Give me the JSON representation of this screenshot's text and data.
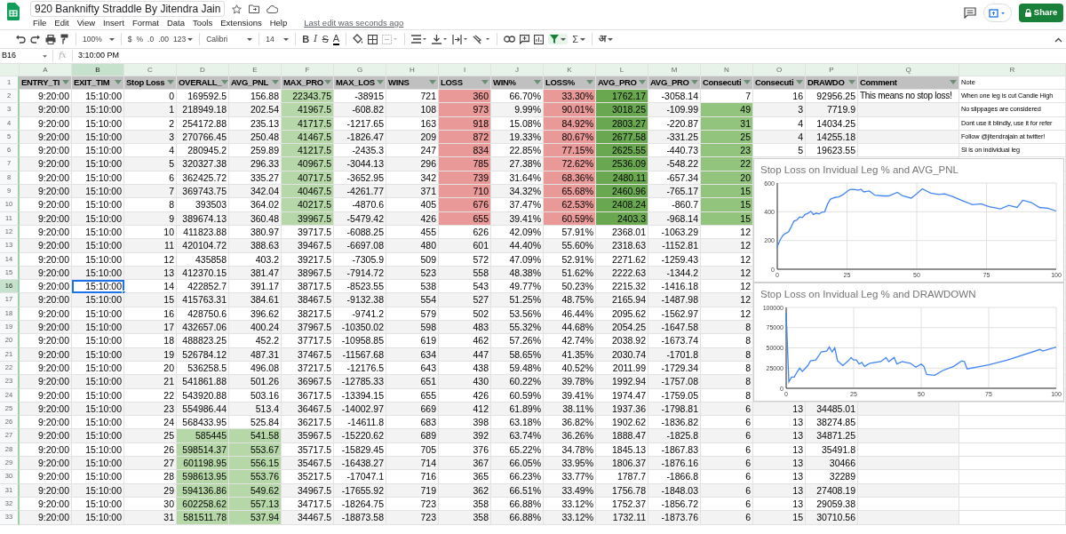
{
  "title": "920 Banknifty Straddle By Jitendra Jain",
  "menu": [
    "File",
    "Edit",
    "View",
    "Insert",
    "Format",
    "Data",
    "Tools",
    "Extensions",
    "Help"
  ],
  "last_edit": "Last edit was seconds ago",
  "share": "Share",
  "toolbar": {
    "zoom": "100%",
    "currency": "$",
    "percent": "%",
    "decrease_decimal": ".0",
    "increase_decimal": ".00",
    "number_format": "123",
    "font": "Calibri",
    "font_size": "14",
    "bold": "B",
    "italic": "I",
    "strikethrough": "S",
    "text_color": "A",
    "functions": "Σ",
    "input_tools": "अ",
    "filter_active": true
  },
  "formula_bar": {
    "cell": "B16",
    "fx": "fx",
    "value": "3:10:00 PM"
  },
  "columns": [
    {
      "letter": "A",
      "selected": false
    },
    {
      "letter": "B",
      "selected": true
    },
    {
      "letter": "C",
      "selected": false
    },
    {
      "letter": "D",
      "selected": false
    },
    {
      "letter": "E",
      "selected": false
    },
    {
      "letter": "F",
      "selected": false
    },
    {
      "letter": "G",
      "selected": false
    },
    {
      "letter": "H",
      "selected": false
    },
    {
      "letter": "I",
      "selected": false
    },
    {
      "letter": "J",
      "selected": false
    },
    {
      "letter": "K",
      "selected": false
    },
    {
      "letter": "L",
      "selected": false
    },
    {
      "letter": "M",
      "selected": false
    },
    {
      "letter": "N",
      "selected": false
    },
    {
      "letter": "O",
      "selected": false
    },
    {
      "letter": "P",
      "selected": false
    },
    {
      "letter": "Q",
      "selected": false
    },
    {
      "letter": "R",
      "selected": false
    }
  ],
  "header_row_number": "1",
  "headers": [
    "ENTRY_TI",
    "EXIT_TIM",
    "Stop Loss",
    "OVERALL_",
    "AVG_PNL",
    "MAX_PRO",
    "MAX_LOS",
    "WINS",
    "LOSS",
    "WIN%",
    "LOSS%",
    "AVG_PRO",
    "AVG_PRO",
    "Consecuti",
    "Consecuti",
    "DRAWDO",
    "Comment"
  ],
  "note_header": "Note",
  "rows": [
    {
      "number": "2",
      "selected": false,
      "cells": [
        "9:20:00",
        "15:10:00",
        "0",
        "169592.5",
        "156.88",
        {
          "text": "22343.75",
          "color": "#b6d7a8"
        },
        "-38915",
        "721",
        {
          "text": "360",
          "color": "#ea9999"
        },
        "66.70%",
        {
          "text": "33.30%",
          "color": "#ea9999"
        },
        {
          "text": "1762.17",
          "color": "#6aa84f"
        },
        "-3058.14",
        "7",
        "16",
        "92956.25"
      ],
      "comment": "This means no stop loss!",
      "note": "When one leg is cut Candle High"
    },
    {
      "number": "3",
      "selected": false,
      "cells": [
        "9:20:00",
        "15:10:00",
        "1",
        "218949.18",
        "202.54",
        {
          "text": "41967.5",
          "color": "#b6d7a8"
        },
        "-608.82",
        "108",
        {
          "text": "973",
          "color": "#ea9999"
        },
        "9.99%",
        {
          "text": "90.01%",
          "color": "#ea9999"
        },
        {
          "text": "3018.25",
          "color": "#6aa84f"
        },
        "-109.99",
        {
          "text": "49",
          "color": "#93c47d"
        },
        "3",
        "7719.9"
      ],
      "note": "No slippages are considered"
    },
    {
      "number": "4",
      "selected": false,
      "cells": [
        "9:20:00",
        "15:10:00",
        "2",
        "254172.88",
        "235.13",
        {
          "text": "41717.5",
          "color": "#b6d7a8"
        },
        "-1217.65",
        "163",
        {
          "text": "918",
          "color": "#ea9999"
        },
        "15.08%",
        {
          "text": "84.92%",
          "color": "#ea9999"
        },
        {
          "text": "2803.27",
          "color": "#6aa84f"
        },
        "-220.87",
        {
          "text": "31",
          "color": "#93c47d"
        },
        "4",
        "14034.25"
      ],
      "note": "Dont use it blindly, use it for refer"
    },
    {
      "number": "5",
      "selected": false,
      "cells": [
        "9:20:00",
        "15:10:00",
        "3",
        "270766.45",
        "250.48",
        {
          "text": "41467.5",
          "color": "#b6d7a8"
        },
        "-1826.47",
        "209",
        {
          "text": "872",
          "color": "#ea9999"
        },
        "19.33%",
        {
          "text": "80.67%",
          "color": "#ea9999"
        },
        {
          "text": "2677.58",
          "color": "#6aa84f"
        },
        "-331.25",
        {
          "text": "25",
          "color": "#93c47d"
        },
        "4",
        "14255.18"
      ],
      "note": "Follow @jitendrajain at twitter!"
    },
    {
      "number": "6",
      "selected": false,
      "cells": [
        "9:20:00",
        "15:10:00",
        "4",
        "280945.2",
        "259.89",
        {
          "text": "41217.5",
          "color": "#b6d7a8"
        },
        "-2435.3",
        "247",
        {
          "text": "834",
          "color": "#ea9999"
        },
        "22.85%",
        {
          "text": "77.15%",
          "color": "#ea9999"
        },
        {
          "text": "2625.55",
          "color": "#6aa84f"
        },
        "-440.73",
        {
          "text": "23",
          "color": "#93c47d"
        },
        "5",
        "19623.55"
      ],
      "note": "Sl is on individual leg"
    },
    {
      "number": "7",
      "selected": false,
      "cells": [
        "9:20:00",
        "15:10:00",
        "5",
        "320327.38",
        "296.33",
        {
          "text": "40967.5",
          "color": "#b6d7a8"
        },
        "-3044.13",
        "296",
        {
          "text": "785",
          "color": "#ea9999"
        },
        "27.38%",
        {
          "text": "72.62%",
          "color": "#ea9999"
        },
        {
          "text": "2536.09",
          "color": "#6aa84f"
        },
        "-548.22",
        {
          "text": "22",
          "color": "#93c47d"
        }
      ]
    },
    {
      "number": "8",
      "selected": false,
      "cells": [
        "9:20:00",
        "15:10:00",
        "6",
        "362425.72",
        "335.27",
        {
          "text": "40717.5",
          "color": "#b6d7a8"
        },
        "-3652.95",
        "342",
        {
          "text": "739",
          "color": "#ea9999"
        },
        "31.64%",
        {
          "text": "68.36%",
          "color": "#ea9999"
        },
        {
          "text": "2480.11",
          "color": "#6aa84f"
        },
        "-657.34",
        {
          "text": "20",
          "color": "#93c47d"
        }
      ]
    },
    {
      "number": "9",
      "selected": false,
      "cells": [
        "9:20:00",
        "15:10:00",
        "7",
        "369743.75",
        "342.04",
        {
          "text": "40467.5",
          "color": "#b6d7a8"
        },
        "-4261.77",
        "371",
        {
          "text": "710",
          "color": "#ea9999"
        },
        "34.32%",
        {
          "text": "65.68%",
          "color": "#ea9999"
        },
        {
          "text": "2460.96",
          "color": "#6aa84f"
        },
        "-765.17",
        {
          "text": "15",
          "color": "#93c47d"
        }
      ]
    },
    {
      "number": "10",
      "selected": false,
      "cells": [
        "9:20:00",
        "15:10:00",
        "8",
        "393503",
        "364.02",
        {
          "text": "40217.5",
          "color": "#b6d7a8"
        },
        "-4870.6",
        "405",
        {
          "text": "676",
          "color": "#ea9999"
        },
        "37.47%",
        {
          "text": "62.53%",
          "color": "#ea9999"
        },
        {
          "text": "2408.24",
          "color": "#6aa84f"
        },
        "-860.7",
        {
          "text": "15",
          "color": "#93c47d"
        }
      ]
    },
    {
      "number": "11",
      "selected": false,
      "cells": [
        "9:20:00",
        "15:10:00",
        "9",
        "389674.13",
        "360.48",
        {
          "text": "39967.5",
          "color": "#b6d7a8"
        },
        "-5479.42",
        "426",
        {
          "text": "655",
          "color": "#ea9999"
        },
        "39.41%",
        {
          "text": "60.59%",
          "color": "#ea9999"
        },
        {
          "text": "2403.3",
          "color": "#6aa84f"
        },
        "-968.14",
        {
          "text": "15",
          "color": "#93c47d"
        }
      ]
    },
    {
      "number": "12",
      "selected": false,
      "cells": [
        "9:20:00",
        "15:10:00",
        "10",
        "411823.88",
        "380.97",
        "39717.5",
        "-6088.25",
        "455",
        "626",
        "42.09%",
        "57.91%",
        "2368.01",
        "-1063.29",
        "12"
      ]
    },
    {
      "number": "13",
      "selected": false,
      "cells": [
        "9:20:00",
        "15:10:00",
        "11",
        "420104.72",
        "388.63",
        "39467.5",
        "-6697.08",
        "480",
        "601",
        "44.40%",
        "55.60%",
        "2318.63",
        "-1152.81",
        "12"
      ]
    },
    {
      "number": "14",
      "selected": false,
      "cells": [
        "9:20:00",
        "15:10:00",
        "12",
        "435858",
        "403.2",
        "39217.5",
        "-7305.9",
        "509",
        "572",
        "47.09%",
        "52.91%",
        "2271.62",
        "-1259.43",
        "12"
      ]
    },
    {
      "number": "15",
      "selected": false,
      "cells": [
        "9:20:00",
        "15:10:00",
        "13",
        "412370.15",
        "381.47",
        "38967.5",
        "-7914.72",
        "523",
        "558",
        "48.38%",
        "51.62%",
        "2222.63",
        "-1344.2",
        "12"
      ]
    },
    {
      "number": "16",
      "selected": true,
      "cells": [
        "9:20:00",
        "15:10:00",
        "14",
        "422852.7",
        "391.17",
        "38717.5",
        "-8523.55",
        "538",
        "543",
        "49.77%",
        "50.23%",
        "2215.32",
        "-1416.18",
        "12"
      ]
    },
    {
      "number": "17",
      "selected": false,
      "cells": [
        "9:20:00",
        "15:10:00",
        "15",
        "415763.31",
        "384.61",
        "38467.5",
        "-9132.38",
        "554",
        "527",
        "51.25%",
        "48.75%",
        "2165.94",
        "-1487.98",
        "12"
      ]
    },
    {
      "number": "18",
      "selected": false,
      "cells": [
        "9:20:00",
        "15:10:00",
        "16",
        "428750.6",
        "396.62",
        "38217.5",
        "-9741.2",
        "579",
        "502",
        "53.56%",
        "46.44%",
        "2095.62",
        "-1562.97",
        "12"
      ]
    },
    {
      "number": "19",
      "selected": false,
      "cells": [
        "9:20:00",
        "15:10:00",
        "17",
        "432657.06",
        "400.24",
        "37967.5",
        "-10350.02",
        "598",
        "483",
        "55.32%",
        "44.68%",
        "2054.25",
        "-1647.58",
        "8"
      ]
    },
    {
      "number": "20",
      "selected": false,
      "cells": [
        "9:20:00",
        "15:10:00",
        "18",
        "488823.25",
        "452.2",
        "37717.5",
        "-10958.85",
        "619",
        "462",
        "57.26%",
        "42.74%",
        "2038.92",
        "-1673.74",
        "8"
      ]
    },
    {
      "number": "21",
      "selected": false,
      "cells": [
        "9:20:00",
        "15:10:00",
        "19",
        "526784.12",
        "487.31",
        "37467.5",
        "-11567.68",
        "634",
        "447",
        "58.65%",
        "41.35%",
        "2030.74",
        "-1701.8",
        "8"
      ]
    },
    {
      "number": "22",
      "selected": false,
      "cells": [
        "9:20:00",
        "15:10:00",
        "20",
        "536258.5",
        "496.08",
        "37217.5",
        "-12176.5",
        "643",
        "438",
        "59.48%",
        "40.52%",
        "2011.99",
        "-1729.34",
        "8"
      ]
    },
    {
      "number": "23",
      "selected": false,
      "cells": [
        "9:20:00",
        "15:10:00",
        "21",
        "541861.88",
        "501.26",
        "36967.5",
        "-12785.33",
        "651",
        "430",
        "60.22%",
        "39.78%",
        "1992.94",
        "-1757.08",
        "8"
      ]
    },
    {
      "number": "24",
      "selected": false,
      "cells": [
        "9:20:00",
        "15:10:00",
        "22",
        "543920.88",
        "503.16",
        "36717.5",
        "-13394.15",
        "655",
        "426",
        "60.59%",
        "39.41%",
        "1974.47",
        "-1759.05",
        "8"
      ]
    },
    {
      "number": "25",
      "selected": false,
      "cells": [
        "9:20:00",
        "15:10:00",
        "23",
        "554986.44",
        "513.4",
        "36467.5",
        "-14002.97",
        "669",
        "412",
        "61.89%",
        "38.11%",
        "1937.36",
        "-1798.81",
        "6",
        "13",
        "34485.01"
      ]
    },
    {
      "number": "26",
      "selected": false,
      "cells": [
        "9:20:00",
        "15:10:00",
        "24",
        "568433.95",
        "525.84",
        "36217.5",
        "-14611.8",
        "683",
        "398",
        "63.18%",
        "36.82%",
        "1902.62",
        "-1836.82",
        "6",
        "13",
        "38274.85"
      ]
    },
    {
      "number": "27",
      "selected": false,
      "cells": [
        "9:20:00",
        "15:10:00",
        "25",
        {
          "text": "585445",
          "color": "#b6d7a8"
        },
        {
          "text": "541.58",
          "color": "#b6d7a8"
        },
        "35967.5",
        "-15220.62",
        "689",
        "392",
        "63.74%",
        "36.26%",
        "1888.47",
        "-1825.8",
        "6",
        "13",
        "34871.25"
      ]
    },
    {
      "number": "28",
      "selected": false,
      "cells": [
        "9:20:00",
        "15:10:00",
        "26",
        {
          "text": "598514.37",
          "color": "#b6d7a8"
        },
        {
          "text": "553.67",
          "color": "#b6d7a8"
        },
        "35717.5",
        "-15829.45",
        "705",
        "376",
        "65.22%",
        "34.78%",
        "1845.13",
        "-1867.83",
        "6",
        "13",
        "35491.8"
      ]
    },
    {
      "number": "29",
      "selected": false,
      "cells": [
        "9:20:00",
        "15:10:00",
        "27",
        {
          "text": "601198.95",
          "color": "#b6d7a8"
        },
        {
          "text": "556.15",
          "color": "#b6d7a8"
        },
        "35467.5",
        "-16438.27",
        "714",
        "367",
        "66.05%",
        "33.95%",
        "1806.37",
        "-1876.16",
        "6",
        "13",
        "30466"
      ]
    },
    {
      "number": "30",
      "selected": false,
      "cells": [
        "9:20:00",
        "15:10:00",
        "28",
        {
          "text": "598613.95",
          "color": "#b6d7a8"
        },
        {
          "text": "553.76",
          "color": "#b6d7a8"
        },
        "35217.5",
        "-17047.1",
        "716",
        "365",
        "66.23%",
        "33.77%",
        "1787.7",
        "-1866.8",
        "6",
        "13",
        "32289"
      ]
    },
    {
      "number": "31",
      "selected": false,
      "cells": [
        "9:20:00",
        "15:10:00",
        "29",
        {
          "text": "594136.86",
          "color": "#b6d7a8"
        },
        {
          "text": "549.62",
          "color": "#b6d7a8"
        },
        "34967.5",
        "-17655.92",
        "719",
        "362",
        "66.51%",
        "33.49%",
        "1756.78",
        "-1848.03",
        "6",
        "13",
        "27408.19"
      ]
    },
    {
      "number": "32",
      "selected": false,
      "cells": [
        "9:20:00",
        "15:10:00",
        "30",
        {
          "text": "602258.62",
          "color": "#b6d7a8"
        },
        {
          "text": "557.13",
          "color": "#b6d7a8"
        },
        "34717.5",
        "-18264.75",
        "723",
        "358",
        "66.88%",
        "33.12%",
        "1752.37",
        "-1856.72",
        "6",
        "13",
        "29059.38"
      ]
    },
    {
      "number": "33",
      "selected": false,
      "cells": [
        "9:20:00",
        "15:10:00",
        "31",
        {
          "text": "581511.78",
          "color": "#b6d7a8"
        },
        {
          "text": "537.94",
          "color": "#b6d7a8"
        },
        "34467.5",
        "-18873.58",
        "723",
        "358",
        "66.88%",
        "33.12%",
        "1732.11",
        "-1873.76",
        "6",
        "15",
        "30710.56"
      ]
    }
  ],
  "charts": [
    {
      "chart_data": {
        "type": "line",
        "title": "Stop Loss on Invidual Leg % and AVG_PNL",
        "grid": true,
        "xlim": [
          0,
          100
        ],
        "ylim": [
          0,
          600
        ],
        "xticks": [
          0,
          25,
          50,
          75,
          100
        ],
        "yticks": [
          0,
          200,
          400,
          600
        ],
        "x": [
          0,
          1,
          2,
          3,
          4,
          5,
          6,
          7,
          8,
          9,
          10,
          11,
          12,
          13,
          14,
          15,
          16,
          17,
          18,
          19,
          20,
          21,
          22,
          23,
          24,
          25,
          26,
          27,
          28,
          29,
          30,
          31,
          33,
          35,
          38,
          40,
          43,
          45,
          48,
          50,
          52,
          55,
          58,
          60,
          63,
          66,
          70,
          73,
          76,
          80,
          83,
          86,
          88,
          91,
          94,
          97,
          100
        ],
        "series": [
          {
            "color": "#4285f4",
            "values": [
              157,
              203,
              235,
              250,
              260,
              296,
              335,
              342,
              364,
              360,
              381,
              389,
              403,
              381,
              391,
              385,
              397,
              400,
              452,
              487,
              496,
              501,
              503,
              513,
              526,
              542,
              554,
              556,
              554,
              550,
              557,
              538,
              545,
              515,
              510,
              510,
              535,
              510,
              495,
              525,
              560,
              530,
              520,
              525,
              505,
              480,
              450,
              455,
              435,
              420,
              445,
              430,
              480,
              465,
              430,
              425,
              405
            ]
          }
        ]
      }
    },
    {
      "chart_data": {
        "type": "line",
        "title": "Stop Loss on Invidual Leg % and DRAWDOWN",
        "grid": true,
        "xlim": [
          0,
          100
        ],
        "ylim": [
          0,
          100000
        ],
        "xticks": [
          0,
          25,
          50,
          75,
          100
        ],
        "yticks": [
          0,
          25000,
          50000,
          75000,
          100000
        ],
        "x": [
          0,
          1,
          2,
          3,
          4,
          5,
          6,
          8,
          9,
          11,
          13,
          15,
          16,
          17,
          18,
          19,
          21,
          23,
          24,
          25,
          26,
          27,
          28,
          29,
          30,
          31,
          35,
          37,
          38,
          40,
          41,
          43,
          46,
          48,
          50,
          51,
          52,
          55,
          58,
          62,
          65,
          66,
          67,
          75,
          82,
          94,
          95,
          100
        ],
        "series": [
          {
            "color": "#4285f4",
            "values": [
              93000,
              8000,
              14000,
              14000,
              20000,
              25000,
              21000,
              28000,
              34000,
              35000,
              45000,
              46000,
              51000,
              45000,
              50000,
              34000,
              28000,
              34000,
              38000,
              35000,
              35000,
              30000,
              32000,
              27000,
              29000,
              31000,
              33000,
              38000,
              33000,
              38000,
              30000,
              33000,
              31000,
              26000,
              30000,
              27000,
              17000,
              16000,
              22000,
              27000,
              34000,
              33000,
              24000,
              29000,
              35000,
              48000,
              46000,
              51000
            ]
          }
        ]
      }
    }
  ]
}
